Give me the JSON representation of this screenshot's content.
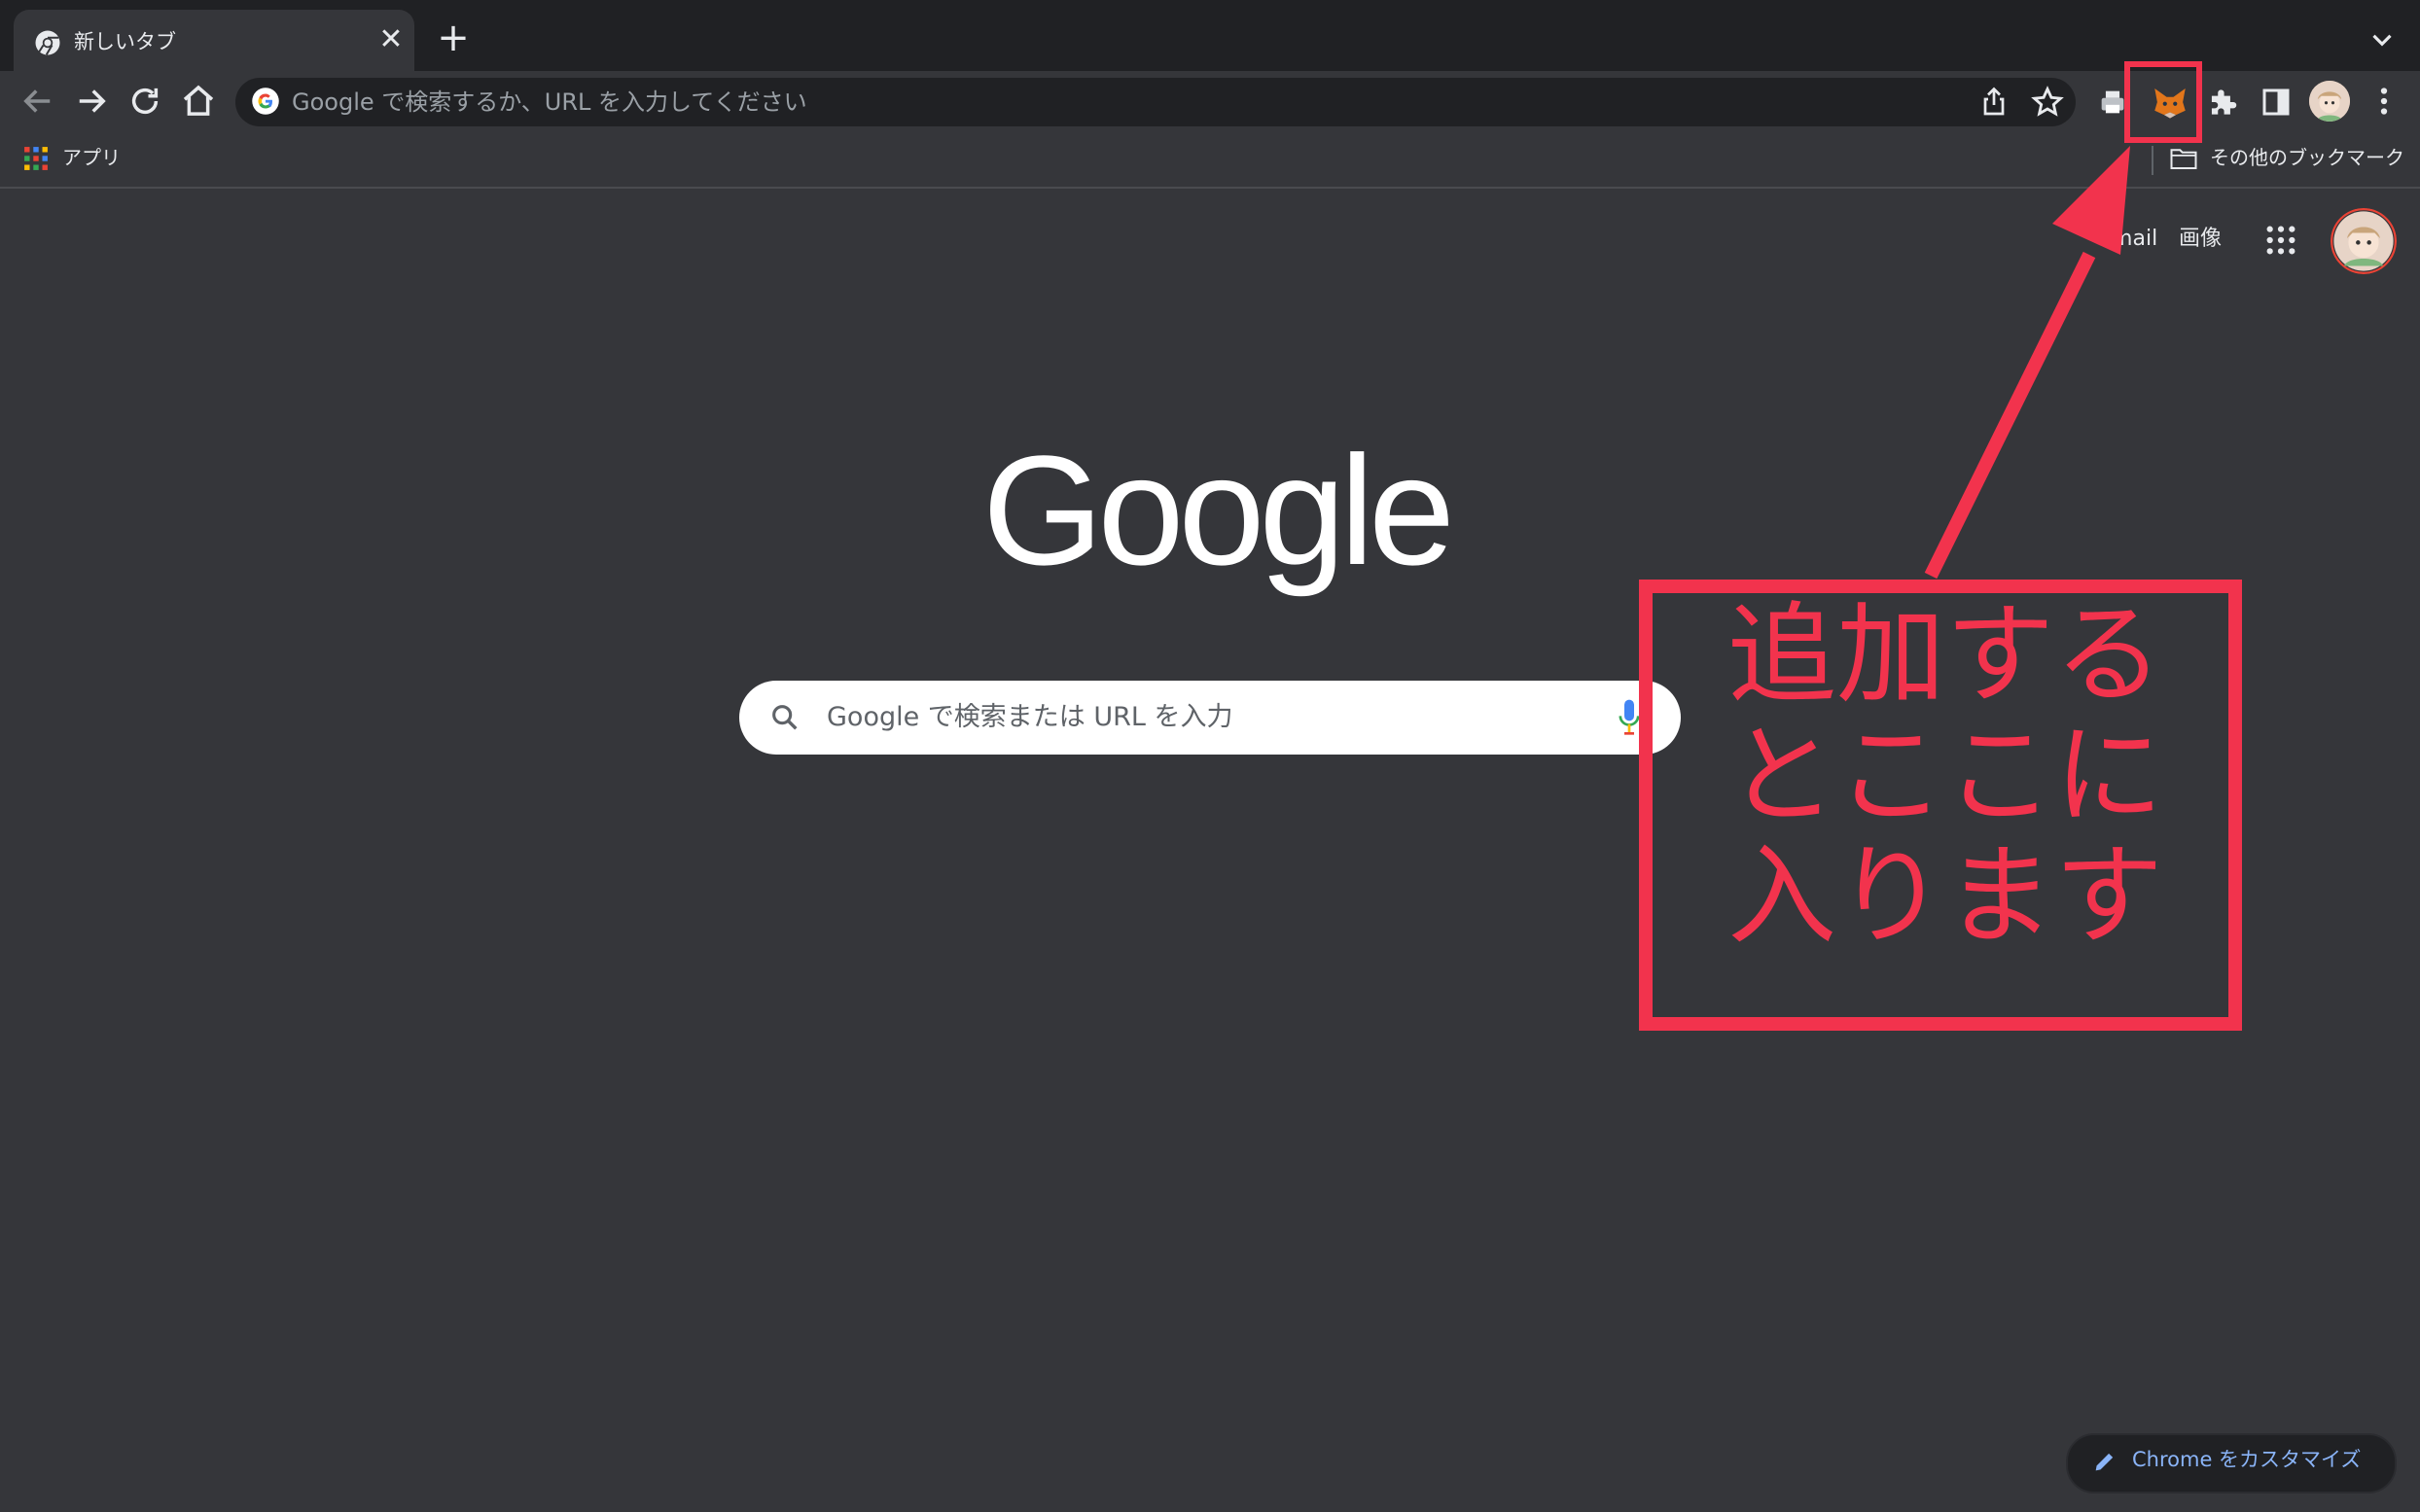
{
  "tab": {
    "title": "新しいタブ",
    "close_glyph": "✕",
    "new_tab_glyph": "+"
  },
  "omnibox": {
    "placeholder": "Google で検索するか、URL を入力してください"
  },
  "bookmarks": {
    "apps_label": "アプリ",
    "other_bookmarks": "その他のブックマーク"
  },
  "header_links": {
    "gmail": "Gmail",
    "images": "画像"
  },
  "search": {
    "placeholder": "Google で検索または URL を入力"
  },
  "customize": {
    "label": "Chrome をカスタマイズ"
  },
  "annotation": {
    "text": "追加する\nとここに\n入ります"
  },
  "icons": {
    "toolbar": [
      "back-arrow-icon",
      "forward-arrow-icon",
      "reload-icon",
      "home-icon"
    ],
    "omnibox": [
      "google-g-icon",
      "share-icon",
      "bookmark-star-icon"
    ],
    "extensions": [
      "printer-extension-icon",
      "metamask-fox-icon",
      "puzzle-extensions-icon",
      "side-panel-icon",
      "profile-avatar",
      "more-menu-icon"
    ]
  },
  "colors": {
    "tab_strip": "#202124",
    "toolbar": "#35363a",
    "page_bg": "#35363a",
    "annotation": "#f2334d",
    "link_blue": "#8ab4f8"
  }
}
